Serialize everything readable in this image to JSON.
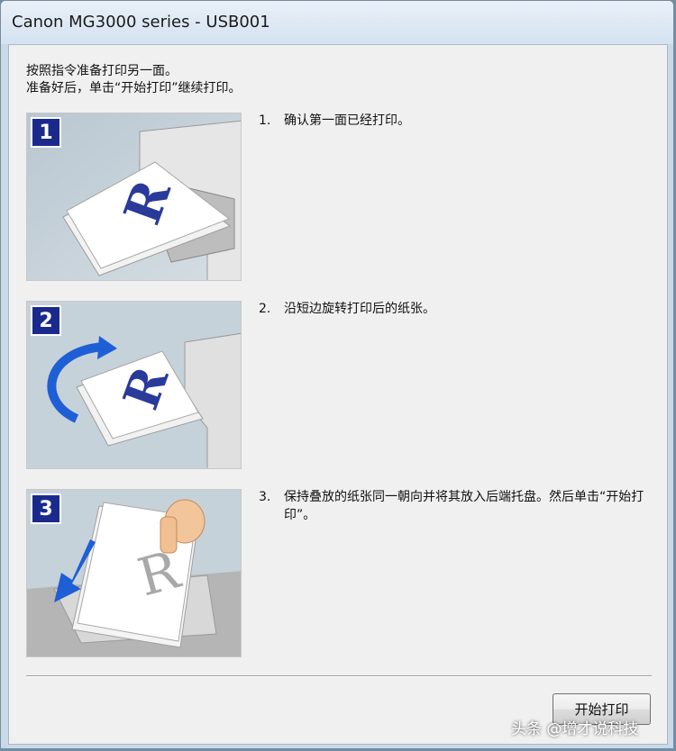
{
  "window": {
    "title": "Canon MG3000 series - USB001"
  },
  "instructions": {
    "line1": "按照指令准备打印另一面。",
    "line2": "准备好后，单击“开始打印”继续打印。"
  },
  "steps": [
    {
      "badge": "1",
      "number": "1.",
      "text": "确认第一面已经打印。"
    },
    {
      "badge": "2",
      "number": "2.",
      "text": "沿短边旋转打印后的纸张。"
    },
    {
      "badge": "3",
      "number": "3.",
      "text": "保持叠放的纸张同一朝向并将其放入后端托盘。然后单击“开始打印”。"
    }
  ],
  "buttons": {
    "start_print": "开始打印"
  },
  "watermark": "头条 @增才说科技",
  "colors": {
    "badge_bg": "#1a2a8c",
    "illustration_bg": "#c6d2da",
    "rotation_arrow": "#1f5fd6",
    "paper_letter": "#2a3a9a"
  }
}
